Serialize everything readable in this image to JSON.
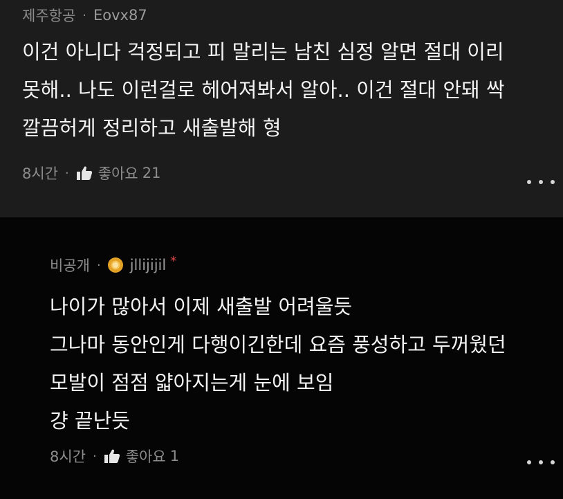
{
  "comments": [
    {
      "category": "제주항공",
      "author": "Eovx87",
      "lines": [
        "이건 아니다 걱정되고 피 말리는 남친 심정 알면 절대 이리",
        "못해.. 나도 이런걸로 헤어져봐서 알아.. 이건 절대 안돼 싹",
        "깔끔허게 정리하고 새출발해 형"
      ],
      "time": "8시간",
      "like_label": "좋아요",
      "like_count": "21"
    },
    {
      "category": "비공개",
      "author": "jllijijil",
      "author_mark": "*",
      "lines": [
        "나이가 많아서 이제 새출발 어려울듯",
        "그나마 동안인게 다행이긴한데 요즘 풍성하고 두꺼웠던",
        "모발이 점점 얇아지는게 눈에 보임",
        "걍 끝난듯"
      ],
      "time": "8시간",
      "like_label": "좋아요",
      "like_count": "1"
    }
  ],
  "separator": "·",
  "icons": {
    "like": "thumbs-up-icon",
    "more": "more-dots-icon",
    "badge": "sun-badge-icon"
  },
  "colors": {
    "top_comment_bg": "#1c1c1c",
    "reply_bg": "#050505",
    "muted_text": "#8d8d8d",
    "body_text": "#f4f4f4",
    "mark_red": "#e04848"
  }
}
